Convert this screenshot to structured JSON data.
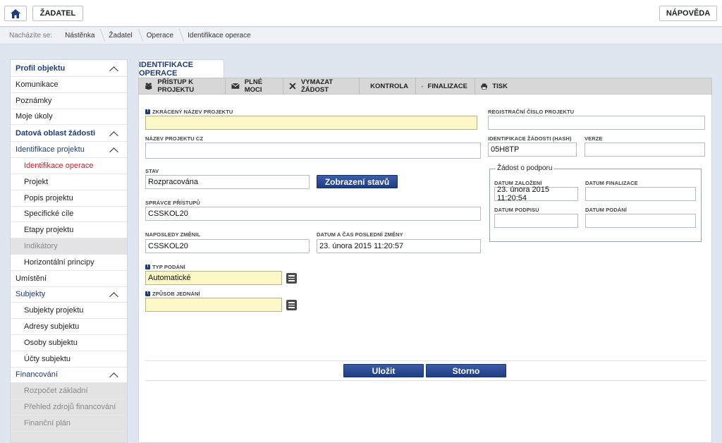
{
  "header": {
    "zadatel_label": "ŽADATEL",
    "help_label": "NÁPOVĚDA"
  },
  "breadcrumb": {
    "prefix": "Nacházíte se:",
    "items": [
      "Nástěnka",
      "Žadatel",
      "Operace",
      "Identifikace operace"
    ]
  },
  "sidebar": {
    "items": [
      {
        "label": "Profil objektu",
        "type": "head",
        "chevron": true
      },
      {
        "label": "Komunikace",
        "type": "item"
      },
      {
        "label": "Poznámky",
        "type": "item"
      },
      {
        "label": "Moje úkoly",
        "type": "item"
      },
      {
        "label": "Datová oblast žádosti",
        "type": "head",
        "chevron": true
      },
      {
        "label": "Identifikace projektu",
        "type": "sub-head",
        "chevron": true
      },
      {
        "label": "Identifikace operace",
        "type": "child active"
      },
      {
        "label": "Projekt",
        "type": "child"
      },
      {
        "label": "Popis projektu",
        "type": "child"
      },
      {
        "label": "Specifické cíle",
        "type": "child"
      },
      {
        "label": "Etapy projektu",
        "type": "child"
      },
      {
        "label": "Indikátory",
        "type": "child disabled"
      },
      {
        "label": "Horizontální principy",
        "type": "child"
      },
      {
        "label": "Umístění",
        "type": "item"
      },
      {
        "label": "Subjekty",
        "type": "sub-head",
        "chevron": true
      },
      {
        "label": "Subjekty projektu",
        "type": "child"
      },
      {
        "label": "Adresy subjektu",
        "type": "child"
      },
      {
        "label": "Osoby subjektu",
        "type": "child"
      },
      {
        "label": "Účty subjektu",
        "type": "child"
      },
      {
        "label": "Financování",
        "type": "sub-head",
        "chevron": true
      },
      {
        "label": "Rozpočet základní",
        "type": "child disabled"
      },
      {
        "label": "Přehled zdrojů financování",
        "type": "child disabled"
      },
      {
        "label": "Finanční plán",
        "type": "child disabled"
      },
      {
        "label": "",
        "type": "child disabled"
      }
    ]
  },
  "panel": {
    "tab_title": "IDENTIFIKACE OPERACE",
    "toolbar": [
      {
        "label": "PŘÍSTUP K PROJEKTU",
        "icon": "people-icon"
      },
      {
        "label": "PLNÉ MOCI",
        "icon": "envelope-icon"
      },
      {
        "label": "VYMAZAT ŽÁDOST",
        "icon": "delete-icon"
      },
      {
        "label": "KONTROLA",
        "icon": "check-icon"
      },
      {
        "label": "FINALIZACE",
        "icon": "lock-icon"
      },
      {
        "label": "TISK",
        "icon": "print-icon"
      }
    ]
  },
  "form": {
    "zkraceny_nazev": {
      "label": "ZKRÁCENÝ NÁZEV PROJEKTU",
      "value": ""
    },
    "nazev_cz": {
      "label": "NÁZEV PROJEKTU CZ",
      "value": ""
    },
    "stav": {
      "label": "STAV",
      "value": "Rozpracována"
    },
    "zobrazeni_stavu": "Zobrazení stavů",
    "spravce": {
      "label": "SPRÁVCE PŘÍSTUPŮ",
      "value": "CSSKOL20"
    },
    "naposledy": {
      "label": "NAPOSLEDY ZMĚNIL",
      "value": "CSSKOL20"
    },
    "datum_zmeny": {
      "label": "DATUM A ČAS POSLEDNÍ ZMĚNY",
      "value": "23. února 2015 11:20:57"
    },
    "typ_podani": {
      "label": "TYP PODÁNÍ",
      "value": "Automatické"
    },
    "zpusob_jednani": {
      "label": "ZPŮSOB JEDNÁNÍ",
      "value": ""
    },
    "registracni_cislo": {
      "label": "REGISTRAČNÍ ČÍSLO PROJEKTU",
      "value": ""
    },
    "identifikace_hash": {
      "label": "IDENTIFIKACE ŽÁDOSTI (HASH)",
      "value": "05H8TP"
    },
    "verze": {
      "label": "VERZE",
      "value": ""
    },
    "zadost": {
      "legend": "Žádost o podporu",
      "datum_zalozeni": {
        "label": "DATUM ZALOŽENÍ",
        "value": "23. února 2015 11:20:54"
      },
      "datum_finalizace": {
        "label": "DATUM FINALIZACE",
        "value": ""
      },
      "datum_podpisu": {
        "label": "DATUM PODPISU",
        "value": ""
      },
      "datum_podani": {
        "label": "DATUM PODÁNÍ",
        "value": ""
      }
    },
    "ulozit": "Uložit",
    "storno": "Storno"
  }
}
